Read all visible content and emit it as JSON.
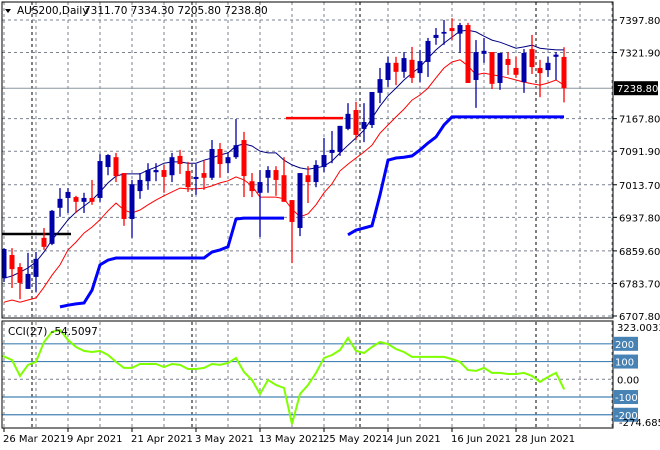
{
  "header": {
    "symbol_timeframe": "AUS200,Daily",
    "ohlc_text": "7311.70 7334.30 7205.80 7238.80"
  },
  "indicator": {
    "label": "CCI(27) -54.5097"
  },
  "colors": {
    "bull": "#0000a8",
    "bear": "#ff0000",
    "ma_fast": "#000080",
    "ma_slow": "#ff0000",
    "support": "#0000ff",
    "cci": "#7fff00",
    "cci_levels": "#4682b4",
    "grid": "#7a8290"
  },
  "chart_data": [
    {
      "type": "candlestick",
      "title": "AUS200,Daily",
      "ylim": [
        6707.8,
        7397.8
      ],
      "y_ticks": [
        "7397.80",
        "7321.90",
        "7167.80",
        "7091.90",
        "7013.70",
        "6937.80",
        "6859.60",
        "6783.70",
        "6707.80"
      ],
      "current_price": "7238.80",
      "x_labels": [
        {
          "index": 0,
          "text": "26 Mar 2021"
        },
        {
          "index": 8,
          "text": "9 Apr 2021"
        },
        {
          "index": 16,
          "text": "21 Apr 2021"
        },
        {
          "index": 24,
          "text": "3 May 2021"
        },
        {
          "index": 32,
          "text": "13 May 2021"
        },
        {
          "index": 40,
          "text": "25 May 2021"
        },
        {
          "index": 48,
          "text": "4 Jun 2021"
        },
        {
          "index": 56,
          "text": "16 Jun 2021"
        },
        {
          "index": 64,
          "text": "28 Jun 2021"
        }
      ],
      "month_separators": [
        4,
        24,
        45,
        67
      ],
      "ohlc": [
        [
          6796,
          6866,
          6787,
          6864
        ],
        [
          6850,
          6866,
          6773,
          6817
        ],
        [
          6822,
          6831,
          6747,
          6785
        ],
        [
          6771,
          6855,
          6771,
          6806
        ],
        [
          6799,
          6857,
          6764,
          6841
        ],
        [
          6890,
          6913,
          6862,
          6869
        ],
        [
          6876,
          6955,
          6873,
          6953
        ],
        [
          6960,
          7006,
          6939,
          6981
        ],
        [
          6983,
          7006,
          6948,
          6997
        ],
        [
          6985,
          6988,
          6948,
          6974
        ],
        [
          6974,
          6995,
          6948,
          6983
        ],
        [
          6983,
          7025,
          6967,
          6974
        ],
        [
          6983,
          7085,
          6974,
          7069
        ],
        [
          7055,
          7085,
          7036,
          7083
        ],
        [
          7078,
          7088,
          7020,
          7034
        ],
        [
          7041,
          7041,
          6918,
          6934
        ],
        [
          6934,
          7025,
          6890,
          7015
        ],
        [
          6999,
          7041,
          6981,
          7025
        ],
        [
          7022,
          7064,
          7002,
          7048
        ],
        [
          7043,
          7064,
          7022,
          7048
        ],
        [
          7048,
          7060,
          6995,
          7032
        ],
        [
          7036,
          7088,
          7020,
          7078
        ],
        [
          7081,
          7095,
          7039,
          7062
        ],
        [
          7046,
          7067,
          6997,
          7008
        ],
        [
          7027,
          7062,
          6990,
          7032
        ],
        [
          7041,
          7071,
          7002,
          7030
        ],
        [
          7030,
          7118,
          7025,
          7097
        ],
        [
          7097,
          7111,
          7030,
          7062
        ],
        [
          7064,
          7090,
          7041,
          7078
        ],
        [
          7078,
          7167,
          7074,
          7106
        ],
        [
          7118,
          7137,
          6985,
          7034
        ],
        [
          7022,
          7041,
          6985,
          6999
        ],
        [
          6995,
          7048,
          6892,
          7020
        ],
        [
          7030,
          7057,
          6995,
          7048
        ],
        [
          7048,
          7057,
          6988,
          7025
        ],
        [
          7036,
          7078,
          6974,
          6974
        ],
        [
          6978,
          6978,
          6831,
          6927
        ],
        [
          6913,
          7041,
          6894,
          7041
        ],
        [
          7036,
          7057,
          6971,
          7020
        ],
        [
          7020,
          7071,
          7008,
          7060
        ],
        [
          7055,
          7123,
          7043,
          7083
        ],
        [
          7088,
          7139,
          7064,
          7095
        ],
        [
          7090,
          7151,
          7081,
          7151
        ],
        [
          7144,
          7204,
          7141,
          7179
        ],
        [
          7188,
          7207,
          7118,
          7130
        ],
        [
          7144,
          7204,
          7113,
          7160
        ],
        [
          7153,
          7230,
          7146,
          7230
        ],
        [
          7228,
          7286,
          7204,
          7260
        ],
        [
          7258,
          7312,
          7242,
          7298
        ],
        [
          7298,
          7312,
          7246,
          7277
        ],
        [
          7277,
          7323,
          7263,
          7309
        ],
        [
          7305,
          7335,
          7251,
          7263
        ],
        [
          7274,
          7328,
          7253,
          7302
        ],
        [
          7300,
          7356,
          7265,
          7349
        ],
        [
          7356,
          7379,
          7340,
          7363
        ],
        [
          7366,
          7398,
          7340,
          7370
        ],
        [
          7379,
          7402,
          7351,
          7372
        ],
        [
          7366,
          7391,
          7321,
          7386
        ],
        [
          7386,
          7391,
          7251,
          7251
        ],
        [
          7258,
          7351,
          7193,
          7323
        ],
        [
          7319,
          7356,
          7298,
          7326
        ],
        [
          7323,
          7323,
          7237,
          7249
        ],
        [
          7251,
          7321,
          7235,
          7321
        ],
        [
          7307,
          7323,
          7270,
          7293
        ],
        [
          7286,
          7312,
          7263,
          7270
        ],
        [
          7253,
          7330,
          7228,
          7321
        ],
        [
          7330,
          7363,
          7272,
          7288
        ],
        [
          7286,
          7305,
          7218,
          7274
        ],
        [
          7281,
          7312,
          7265,
          7298
        ],
        [
          7312,
          7323,
          7258,
          7317
        ],
        [
          7311.7,
          7334.3,
          7205.8,
          7238.8
        ]
      ],
      "series": [
        {
          "name": "ma_fast",
          "values": [
            6796,
            6801,
            6810,
            6820,
            6834,
            6857,
            6885,
            6908,
            6932,
            6950,
            6964,
            6978,
            6997,
            7018,
            7034,
            7039,
            7039,
            7039,
            7048,
            7055,
            7064,
            7067,
            7067,
            7064,
            7064,
            7071,
            7076,
            7083,
            7088,
            7104,
            7109,
            7104,
            7092,
            7088,
            7088,
            7071,
            7060,
            7053,
            7050,
            7053,
            7057,
            7069,
            7088,
            7106,
            7123,
            7141,
            7169,
            7197,
            7221,
            7239,
            7258,
            7274,
            7288,
            7309,
            7328,
            7344,
            7358,
            7372,
            7374,
            7370,
            7360,
            7351,
            7346,
            7339,
            7332,
            7335,
            7339,
            7332,
            7330,
            7328,
            7328
          ]
        },
        {
          "name": "ma_slow",
          "values": [
            6740,
            6745,
            6740,
            6745,
            6750,
            6775,
            6803,
            6827,
            6862,
            6880,
            6901,
            6915,
            6932,
            6953,
            6971,
            6955,
            6948,
            6955,
            6967,
            6978,
            6988,
            6997,
            7006,
            7004,
            7004,
            7006,
            7011,
            7018,
            7023,
            7032,
            7025,
            7011,
            6985,
            6985,
            6985,
            6981,
            6957,
            6939,
            6946,
            6967,
            6995,
            7016,
            7046,
            7062,
            7076,
            7090,
            7106,
            7134,
            7153,
            7172,
            7190,
            7211,
            7223,
            7239,
            7263,
            7286,
            7300,
            7305,
            7291,
            7270,
            7274,
            7270,
            7267,
            7263,
            7258,
            7253,
            7249,
            7246,
            7251,
            7258,
            7246
          ]
        },
        {
          "name": "support",
          "values": [
            null,
            null,
            null,
            null,
            null,
            null,
            null,
            6729,
            6733,
            6736,
            6738,
            6768,
            6827,
            6838,
            6843,
            6843,
            6843,
            6843,
            6843,
            6843,
            6843,
            6843,
            6843,
            6843,
            6843,
            6843,
            6857,
            6862,
            6869,
            6934,
            6936,
            6936,
            6936,
            6936,
            6936,
            6936,
            null,
            null,
            null,
            null,
            null,
            null,
            null,
            6897,
            6908,
            6913,
            6918,
            6990,
            7071,
            7076,
            7078,
            7081,
            7095,
            7111,
            7125,
            7153,
            7172,
            7172,
            7172,
            7172,
            7172,
            7172,
            7172,
            7172,
            7172,
            7172,
            7172,
            7172,
            7172,
            7172,
            7172
          ]
        }
      ],
      "levels": [
        {
          "name": "black-level",
          "price": 6899,
          "from": 0,
          "to": 8,
          "color": "#000000"
        },
        {
          "name": "red-level",
          "price": 7169,
          "from": 36,
          "to": 42,
          "color": "#ff0000"
        }
      ]
    },
    {
      "type": "line",
      "title": "CCI(27)",
      "ylim": [
        -274.685,
        323.0033
      ],
      "y_labels": {
        "top": "323.0033",
        "bottom": "-274.685",
        "zero": "0.00"
      },
      "levels": [
        "200",
        "100",
        "-100",
        "-200"
      ],
      "values": [
        131,
        109,
        19,
        81,
        98,
        210,
        267,
        278,
        222,
        182,
        160,
        154,
        160,
        137,
        98,
        64,
        64,
        86,
        86,
        86,
        69,
        86,
        81,
        58,
        58,
        64,
        86,
        81,
        92,
        120,
        41,
        -4,
        -83,
        -4,
        -32,
        -49,
        -252,
        -83,
        -32,
        36,
        120,
        137,
        165,
        233,
        160,
        148,
        182,
        210,
        199,
        171,
        154,
        126,
        126,
        126,
        126,
        126,
        114,
        98,
        52,
        47,
        64,
        36,
        36,
        30,
        30,
        36,
        19,
        -15,
        13,
        36,
        -54.5097
      ]
    }
  ]
}
